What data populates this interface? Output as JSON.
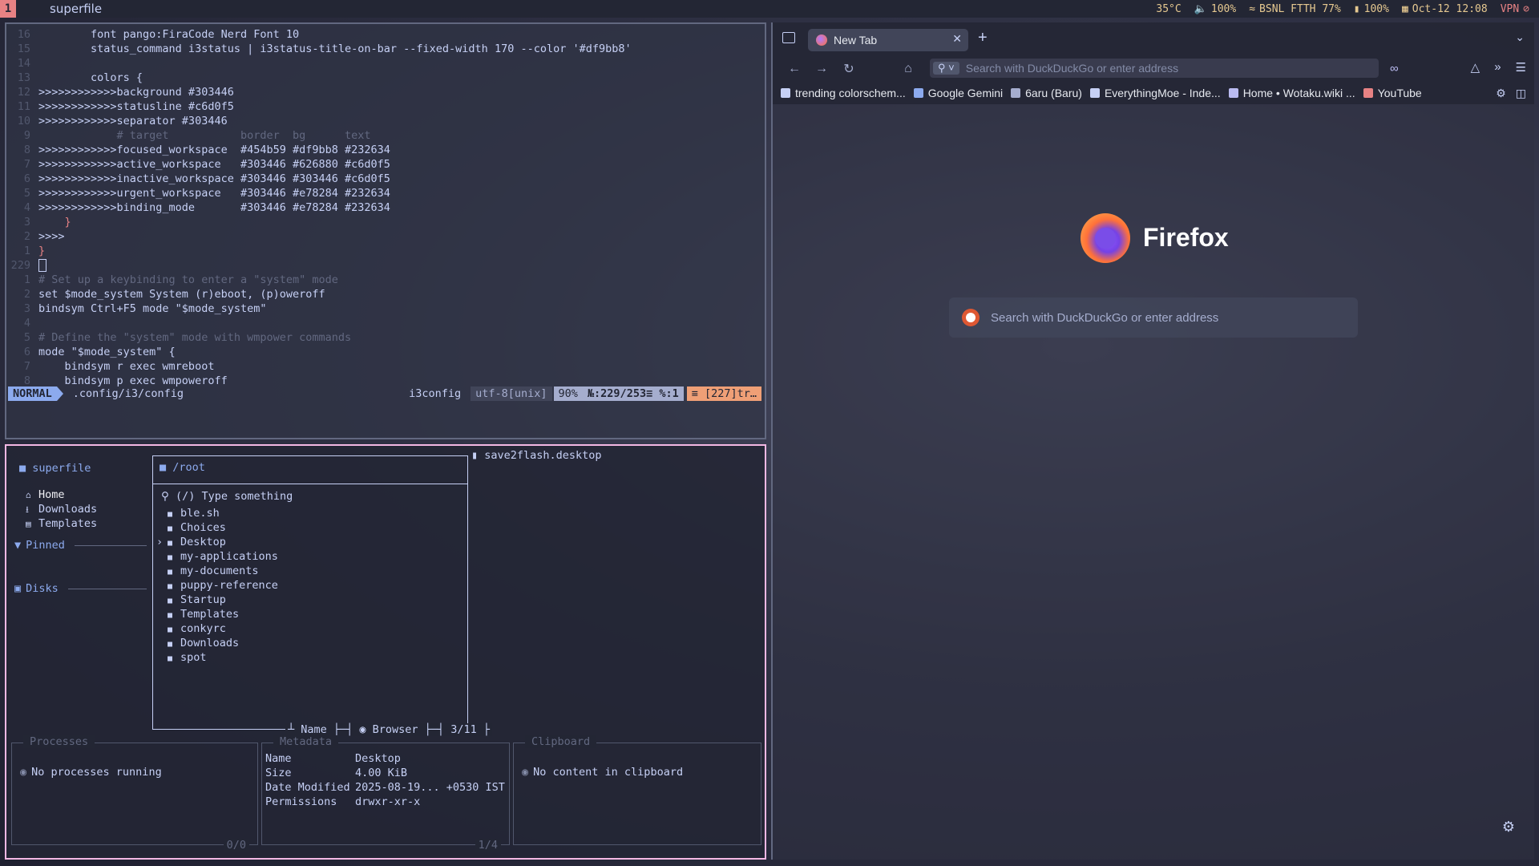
{
  "topbar": {
    "workspace": "1",
    "title": "superfile",
    "temp": "35°C",
    "volume": "100%",
    "network": "BSNL FTTH 77%",
    "battery": "100%",
    "datetime": "Oct-12 12:08",
    "vpn": "VPN"
  },
  "vim": {
    "lines": [
      {
        "n": "16",
        "code": "        font pango:FiraCode Nerd Font 10"
      },
      {
        "n": "15",
        "code": "        status_command i3status | i3status-title-on-bar --fixed-width 170 --color '#df9bb8'"
      },
      {
        "n": "14",
        "code": ""
      },
      {
        "n": "13",
        "code": "        colors {"
      },
      {
        "n": "12",
        "code": ">>>>>>>>>>>>background #303446"
      },
      {
        "n": "11",
        "code": ">>>>>>>>>>>>statusline #c6d0f5"
      },
      {
        "n": "10",
        "code": ">>>>>>>>>>>>separator #303446"
      },
      {
        "n": "9",
        "code": "            # target           border  bg      text"
      },
      {
        "n": "8",
        "code": ">>>>>>>>>>>>focused_workspace  #454b59 #df9bb8 #232634"
      },
      {
        "n": "7",
        "code": ">>>>>>>>>>>>active_workspace   #303446 #626880 #c6d0f5"
      },
      {
        "n": "6",
        "code": ">>>>>>>>>>>>inactive_workspace #303446 #303446 #c6d0f5"
      },
      {
        "n": "5",
        "code": ">>>>>>>>>>>>urgent_workspace   #303446 #e78284 #232634"
      },
      {
        "n": "4",
        "code": ">>>>>>>>>>>>binding_mode       #303446 #e78284 #232634"
      },
      {
        "n": "3",
        "code": "    }"
      },
      {
        "n": "2",
        "code": ">>>>"
      },
      {
        "n": "1",
        "code": "}"
      },
      {
        "n": "229",
        "code": ""
      },
      {
        "n": "1",
        "code": "# Set up a keybinding to enter a \"system\" mode"
      },
      {
        "n": "2",
        "code": "set $mode_system System (r)eboot, (p)oweroff"
      },
      {
        "n": "3",
        "code": "bindsym Ctrl+F5 mode \"$mode_system\""
      },
      {
        "n": "4",
        "code": ""
      },
      {
        "n": "5",
        "code": "# Define the \"system\" mode with wmpower commands"
      },
      {
        "n": "6",
        "code": "mode \"$mode_system\" {"
      },
      {
        "n": "7",
        "code": "    bindsym r exec wmreboot"
      },
      {
        "n": "8",
        "code": "    bindsym p exec wmpoweroff"
      }
    ],
    "status": {
      "mode": "NORMAL",
      "file": ".config/i3/config",
      "filetype": "i3config",
      "encoding": "utf-8[unix]",
      "percent": "90%",
      "position": "№:229/253≡ %:1",
      "trail": "≡ [227]tr…"
    }
  },
  "superfile": {
    "app": "superfile",
    "sidebar": {
      "items": [
        {
          "icon": "home-icon",
          "label": "Home",
          "glyph": "⌂"
        },
        {
          "icon": "download-icon",
          "label": "Downloads",
          "glyph": "⭳"
        },
        {
          "icon": "template-icon",
          "label": "Templates",
          "glyph": "▤"
        }
      ],
      "pinned": "Pinned",
      "disks": "Disks"
    },
    "browser": {
      "path": "/root",
      "search": "(/) Type something",
      "files": [
        "ble.sh",
        "Choices",
        "Desktop",
        "my-applications",
        "my-documents",
        "puppy-reference",
        "Startup",
        "Templates",
        "conkyrc",
        "Downloads",
        "spot"
      ],
      "selected": "Desktop",
      "footer": "┴ Name ├─┤ ◉ Browser ├─┤ 3/11 ├"
    },
    "preview_file": "save2flash.desktop",
    "processes": {
      "title": "Processes",
      "text": "No processes running",
      "count": "0/0"
    },
    "metadata": {
      "title": "Metadata",
      "rows": [
        {
          "k": "Name",
          "v": "Desktop"
        },
        {
          "k": "Size",
          "v": "4.00 KiB"
        },
        {
          "k": "Date Modified",
          "v": "2025-08-19... +0530 IST"
        },
        {
          "k": "Permissions",
          "v": "drwxr-xr-x"
        }
      ],
      "count": "1/4"
    },
    "clipboard": {
      "title": "Clipboard",
      "text": "No content in clipboard"
    }
  },
  "firefox": {
    "tab_title": "New Tab",
    "url_placeholder": "Search with DuckDuckGo or enter address",
    "bookmarks": [
      {
        "label": "trending colorschem...",
        "color": "#c6d0f5"
      },
      {
        "label": "Google Gemini",
        "color": "#8caaee"
      },
      {
        "label": "6aru (Baru)",
        "color": "#a5adce"
      },
      {
        "label": "EverythingMoe - Inde...",
        "color": "#c6d0f5"
      },
      {
        "label": "Home • Wotaku.wiki ...",
        "color": "#babbf1"
      },
      {
        "label": "YouTube",
        "color": "#e78284"
      }
    ],
    "brand": "Firefox",
    "search_placeholder": "Search with DuckDuckGo or enter address"
  }
}
